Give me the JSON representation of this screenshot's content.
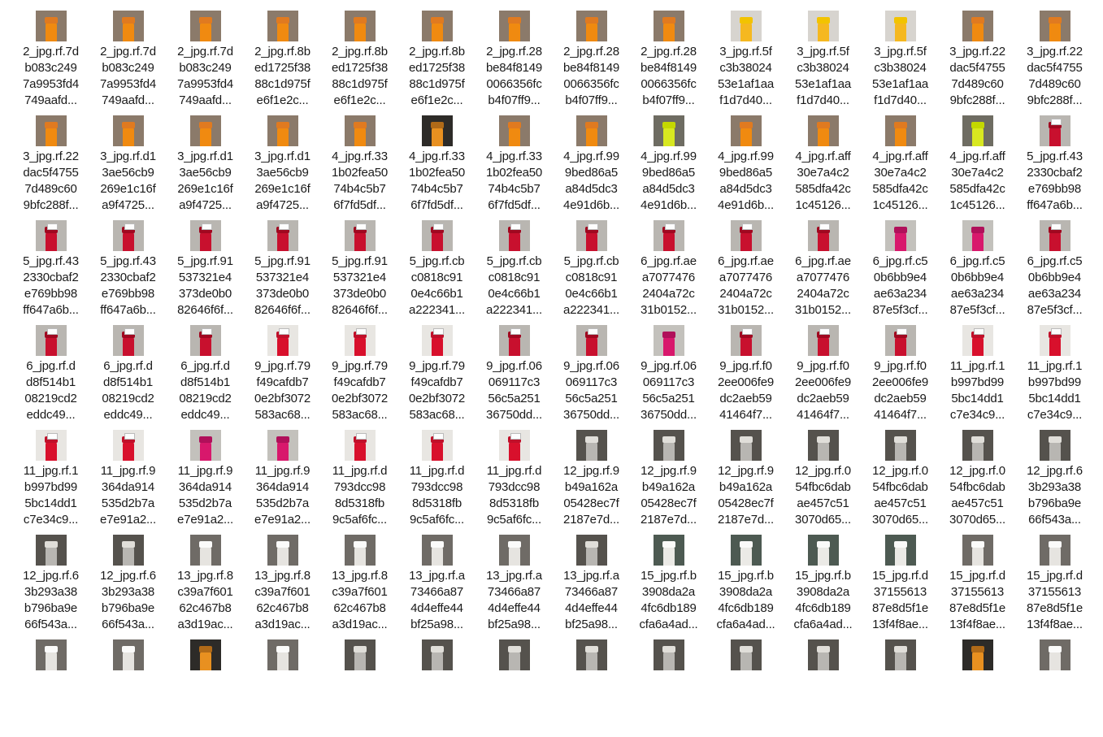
{
  "files": [
    {
      "name": "2_jpg.rf.7d\nb083c249\n7a9953fd4\n749aafd...",
      "thumb": "orange"
    },
    {
      "name": "2_jpg.rf.7d\nb083c249\n7a9953fd4\n749aafd...",
      "thumb": "orange"
    },
    {
      "name": "2_jpg.rf.7d\nb083c249\n7a9953fd4\n749aafd...",
      "thumb": "orange"
    },
    {
      "name": "2_jpg.rf.8b\ned1725f38\n88c1d975f\ne6f1e2c...",
      "thumb": "orange"
    },
    {
      "name": "2_jpg.rf.8b\ned1725f38\n88c1d975f\ne6f1e2c...",
      "thumb": "orange"
    },
    {
      "name": "2_jpg.rf.8b\ned1725f38\n88c1d975f\ne6f1e2c...",
      "thumb": "orange"
    },
    {
      "name": "2_jpg.rf.28\nbe84f8149\n0066356fc\nb4f07ff9...",
      "thumb": "orange"
    },
    {
      "name": "2_jpg.rf.28\nbe84f8149\n0066356fc\nb4f07ff9...",
      "thumb": "orange"
    },
    {
      "name": "2_jpg.rf.28\nbe84f8149\n0066356fc\nb4f07ff9...",
      "thumb": "orange"
    },
    {
      "name": "3_jpg.rf.5f\nc3b38024\n53e1af1aa\nf1d7d40...",
      "thumb": "yellow"
    },
    {
      "name": "3_jpg.rf.5f\nc3b38024\n53e1af1aa\nf1d7d40...",
      "thumb": "yellow"
    },
    {
      "name": "3_jpg.rf.5f\nc3b38024\n53e1af1aa\nf1d7d40...",
      "thumb": "yellow"
    },
    {
      "name": "3_jpg.rf.22\ndac5f4755\n7d489c60\n9bfc288f...",
      "thumb": "orange"
    },
    {
      "name": "3_jpg.rf.22\ndac5f4755\n7d489c60\n9bfc288f...",
      "thumb": "orange"
    },
    {
      "name": "3_jpg.rf.22\ndac5f4755\n7d489c60\n9bfc288f...",
      "thumb": "orange"
    },
    {
      "name": "3_jpg.rf.d1\n3ae56cb9\n269e1c16f\na9f4725...",
      "thumb": "orange"
    },
    {
      "name": "3_jpg.rf.d1\n3ae56cb9\n269e1c16f\na9f4725...",
      "thumb": "orange"
    },
    {
      "name": "3_jpg.rf.d1\n3ae56cb9\n269e1c16f\na9f4725...",
      "thumb": "orange"
    },
    {
      "name": "4_jpg.rf.33\n1b02fea50\n74b4c5b7\n6f7fd5df...",
      "thumb": "orange"
    },
    {
      "name": "4_jpg.rf.33\n1b02fea50\n74b4c5b7\n6f7fd5df...",
      "thumb": "dark"
    },
    {
      "name": "4_jpg.rf.33\n1b02fea50\n74b4c5b7\n6f7fd5df...",
      "thumb": "orange"
    },
    {
      "name": "4_jpg.rf.99\n9bed86a5\na84d5dc3\n4e91d6b...",
      "thumb": "orange"
    },
    {
      "name": "4_jpg.rf.99\n9bed86a5\na84d5dc3\n4e91d6b...",
      "thumb": "lime"
    },
    {
      "name": "4_jpg.rf.99\n9bed86a5\na84d5dc3\n4e91d6b...",
      "thumb": "orange"
    },
    {
      "name": "4_jpg.rf.aff\n30e7a4c2\n585dfa42c\n1c45126...",
      "thumb": "orange"
    },
    {
      "name": "4_jpg.rf.aff\n30e7a4c2\n585dfa42c\n1c45126...",
      "thumb": "orange"
    },
    {
      "name": "4_jpg.rf.aff\n30e7a4c2\n585dfa42c\n1c45126...",
      "thumb": "lime"
    },
    {
      "name": "5_jpg.rf.43\n2330cbaf2\ne769bb98\nff647a6b...",
      "thumb": "red"
    },
    {
      "name": "5_jpg.rf.43\n2330cbaf2\ne769bb98\nff647a6b...",
      "thumb": "red"
    },
    {
      "name": "5_jpg.rf.43\n2330cbaf2\ne769bb98\nff647a6b...",
      "thumb": "red"
    },
    {
      "name": "5_jpg.rf.91\n537321e4\n373de0b0\n82646f6f...",
      "thumb": "red"
    },
    {
      "name": "5_jpg.rf.91\n537321e4\n373de0b0\n82646f6f...",
      "thumb": "red"
    },
    {
      "name": "5_jpg.rf.91\n537321e4\n373de0b0\n82646f6f...",
      "thumb": "red"
    },
    {
      "name": "5_jpg.rf.cb\nc0818c91\n0e4c66b1\na222341...",
      "thumb": "red"
    },
    {
      "name": "5_jpg.rf.cb\nc0818c91\n0e4c66b1\na222341...",
      "thumb": "red"
    },
    {
      "name": "5_jpg.rf.cb\nc0818c91\n0e4c66b1\na222341...",
      "thumb": "red"
    },
    {
      "name": "6_jpg.rf.ae\na7077476\n2404a72c\n31b0152...",
      "thumb": "red"
    },
    {
      "name": "6_jpg.rf.ae\na7077476\n2404a72c\n31b0152...",
      "thumb": "red"
    },
    {
      "name": "6_jpg.rf.ae\na7077476\n2404a72c\n31b0152...",
      "thumb": "red"
    },
    {
      "name": "6_jpg.rf.c5\n0b6bb9e4\nae63a234\n87e5f3cf...",
      "thumb": "magenta"
    },
    {
      "name": "6_jpg.rf.c5\n0b6bb9e4\nae63a234\n87e5f3cf...",
      "thumb": "magenta"
    },
    {
      "name": "6_jpg.rf.c5\n0b6bb9e4\nae63a234\n87e5f3cf...",
      "thumb": "red"
    },
    {
      "name": "6_jpg.rf.d\nd8f514b1\n08219cd2\neddc49...",
      "thumb": "red"
    },
    {
      "name": "6_jpg.rf.d\nd8f514b1\n08219cd2\neddc49...",
      "thumb": "red"
    },
    {
      "name": "6_jpg.rf.d\nd8f514b1\n08219cd2\neddc49...",
      "thumb": "red"
    },
    {
      "name": "9_jpg.rf.79\nf49cafdb7\n0e2bf3072\n583ac68...",
      "thumb": "red-white"
    },
    {
      "name": "9_jpg.rf.79\nf49cafdb7\n0e2bf3072\n583ac68...",
      "thumb": "red-white"
    },
    {
      "name": "9_jpg.rf.79\nf49cafdb7\n0e2bf3072\n583ac68...",
      "thumb": "red-white"
    },
    {
      "name": "9_jpg.rf.06\n069117c3\n56c5a251\n36750dd...",
      "thumb": "red"
    },
    {
      "name": "9_jpg.rf.06\n069117c3\n56c5a251\n36750dd...",
      "thumb": "red"
    },
    {
      "name": "9_jpg.rf.06\n069117c3\n56c5a251\n36750dd...",
      "thumb": "magenta"
    },
    {
      "name": "9_jpg.rf.f0\n2ee006fe9\ndc2aeb59\n41464f7...",
      "thumb": "red"
    },
    {
      "name": "9_jpg.rf.f0\n2ee006fe9\ndc2aeb59\n41464f7...",
      "thumb": "red"
    },
    {
      "name": "9_jpg.rf.f0\n2ee006fe9\ndc2aeb59\n41464f7...",
      "thumb": "red"
    },
    {
      "name": "11_jpg.rf.1\nb997bd99\n5bc14dd1\nc7e34c9...",
      "thumb": "red-white"
    },
    {
      "name": "11_jpg.rf.1\nb997bd99\n5bc14dd1\nc7e34c9...",
      "thumb": "red-white"
    },
    {
      "name": "11_jpg.rf.1\nb997bd99\n5bc14dd1\nc7e34c9...",
      "thumb": "red-white"
    },
    {
      "name": "11_jpg.rf.9\n364da914\n535d2b7a\ne7e91a2...",
      "thumb": "red-white"
    },
    {
      "name": "11_jpg.rf.9\n364da914\n535d2b7a\ne7e91a2...",
      "thumb": "magenta"
    },
    {
      "name": "11_jpg.rf.9\n364da914\n535d2b7a\ne7e91a2...",
      "thumb": "magenta"
    },
    {
      "name": "11_jpg.rf.d\n793dcc98\n8d5318fb\n9c5af6fc...",
      "thumb": "red-white"
    },
    {
      "name": "11_jpg.rf.d\n793dcc98\n8d5318fb\n9c5af6fc...",
      "thumb": "red-white"
    },
    {
      "name": "11_jpg.rf.d\n793dcc98\n8d5318fb\n9c5af6fc...",
      "thumb": "red-white"
    },
    {
      "name": "12_jpg.rf.9\nb49a162a\n05428ec7f\n2187e7d...",
      "thumb": "clear"
    },
    {
      "name": "12_jpg.rf.9\nb49a162a\n05428ec7f\n2187e7d...",
      "thumb": "clear"
    },
    {
      "name": "12_jpg.rf.9\nb49a162a\n05428ec7f\n2187e7d...",
      "thumb": "clear"
    },
    {
      "name": "12_jpg.rf.0\n54fbc6dab\nae457c51\n3070d65...",
      "thumb": "clear"
    },
    {
      "name": "12_jpg.rf.0\n54fbc6dab\nae457c51\n3070d65...",
      "thumb": "clear"
    },
    {
      "name": "12_jpg.rf.0\n54fbc6dab\nae457c51\n3070d65...",
      "thumb": "clear"
    },
    {
      "name": "12_jpg.rf.6\n3b293a38\nb796ba9e\n66f543a...",
      "thumb": "clear"
    },
    {
      "name": "12_jpg.rf.6\n3b293a38\nb796ba9e\n66f543a...",
      "thumb": "clear"
    },
    {
      "name": "12_jpg.rf.6\n3b293a38\nb796ba9e\n66f543a...",
      "thumb": "clear"
    },
    {
      "name": "13_jpg.rf.8\nc39a7f601\n62c467b8\na3d19ac...",
      "thumb": "white"
    },
    {
      "name": "13_jpg.rf.8\nc39a7f601\n62c467b8\na3d19ac...",
      "thumb": "white"
    },
    {
      "name": "13_jpg.rf.8\nc39a7f601\n62c467b8\na3d19ac...",
      "thumb": "white"
    },
    {
      "name": "13_jpg.rf.a\n73466a87\n4d4effe44\nbf25a98...",
      "thumb": "white"
    },
    {
      "name": "13_jpg.rf.a\n73466a87\n4d4effe44\nbf25a98...",
      "thumb": "white"
    },
    {
      "name": "13_jpg.rf.a\n73466a87\n4d4effe44\nbf25a98...",
      "thumb": "clear"
    },
    {
      "name": "15_jpg.rf.b\n3908da2a\n4fc6db189\ncfa6a4ad...",
      "thumb": "green"
    },
    {
      "name": "15_jpg.rf.b\n3908da2a\n4fc6db189\ncfa6a4ad...",
      "thumb": "green"
    },
    {
      "name": "15_jpg.rf.b\n3908da2a\n4fc6db189\ncfa6a4ad...",
      "thumb": "green"
    },
    {
      "name": "15_jpg.rf.d\n37155613\n87e8d5f1e\n13f4f8ae...",
      "thumb": "green"
    },
    {
      "name": "15_jpg.rf.d\n37155613\n87e8d5f1e\n13f4f8ae...",
      "thumb": "white"
    },
    {
      "name": "15_jpg.rf.d\n37155613\n87e8d5f1e\n13f4f8ae...",
      "thumb": "white"
    },
    {
      "name": "",
      "thumb": "white"
    },
    {
      "name": "",
      "thumb": "white"
    },
    {
      "name": "",
      "thumb": "dark"
    },
    {
      "name": "",
      "thumb": "white"
    },
    {
      "name": "",
      "thumb": "clear"
    },
    {
      "name": "",
      "thumb": "clear"
    },
    {
      "name": "",
      "thumb": "clear"
    },
    {
      "name": "",
      "thumb": "clear"
    },
    {
      "name": "",
      "thumb": "clear"
    },
    {
      "name": "",
      "thumb": "clear"
    },
    {
      "name": "",
      "thumb": "clear"
    },
    {
      "name": "",
      "thumb": "clear"
    },
    {
      "name": "",
      "thumb": "dark"
    },
    {
      "name": "",
      "thumb": "white"
    }
  ],
  "thumb_colors": {
    "orange": {
      "bg": "#8b7a6a",
      "liquid": "#f08a10",
      "cap": "#e07a20"
    },
    "yellow": {
      "bg": "#d7d4cf",
      "liquid": "#f5b820",
      "cap": "#f2c300"
    },
    "dark": {
      "bg": "#2d2b28",
      "liquid": "#e89020",
      "cap": "#b06a18"
    },
    "lime": {
      "bg": "#6e6c62",
      "liquid": "#d8e820",
      "cap": "#c4d800"
    },
    "red": {
      "bg": "#b9b6b1",
      "liquid": "#c8102e",
      "cap": "#a00820"
    },
    "magenta": {
      "bg": "#c3c1bc",
      "liquid": "#d8186c",
      "cap": "#b0105a"
    },
    "red-white": {
      "bg": "#e8e6e2",
      "liquid": "#d8102c",
      "cap": "#c0102a"
    },
    "clear": {
      "bg": "#55524d",
      "liquid": "#b8b6b2",
      "cap": "#e0ded9"
    },
    "white": {
      "bg": "#6f6b66",
      "liquid": "#e6e4e0",
      "cap": "#fbfbfa"
    },
    "green": {
      "bg": "#4d5a52",
      "liquid": "#ebeae6",
      "cap": "#fafaf9"
    }
  }
}
